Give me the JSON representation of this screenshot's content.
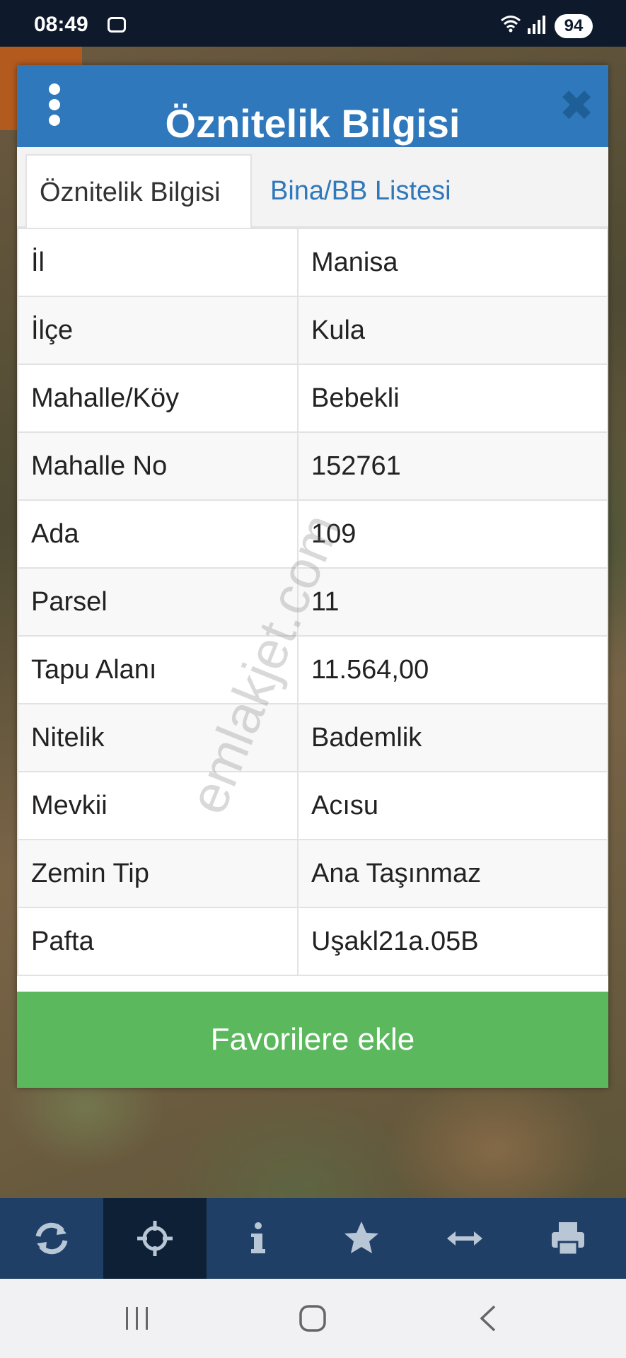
{
  "status_bar": {
    "time": "08:49",
    "battery": "94"
  },
  "modal": {
    "title": "Öznitelik Bilgisi",
    "tabs": [
      {
        "label": "Öznitelik Bilgisi",
        "active": true
      },
      {
        "label": "Bina/BB Listesi",
        "active": false
      }
    ],
    "rows": [
      {
        "key": "İl",
        "value": "Manisa"
      },
      {
        "key": "İlçe",
        "value": "Kula"
      },
      {
        "key": "Mahalle/Köy",
        "value": "Bebekli"
      },
      {
        "key": "Mahalle No",
        "value": "152761"
      },
      {
        "key": "Ada",
        "value": "109"
      },
      {
        "key": "Parsel",
        "value": "11"
      },
      {
        "key": "Tapu Alanı",
        "value": "11.564,00"
      },
      {
        "key": "Nitelik",
        "value": "Bademlik"
      },
      {
        "key": "Mevkii",
        "value": "Acısu"
      },
      {
        "key": "Zemin Tip",
        "value": "Ana Taşınmaz"
      },
      {
        "key": "Pafta",
        "value": "Uşakl21a.05B"
      }
    ],
    "favorite_button": "Favorilere ekle"
  },
  "watermark": "emlakjet.com",
  "toolbar": {
    "items": [
      "refresh-icon",
      "crosshair-icon",
      "info-icon",
      "star-icon",
      "measure-icon",
      "print-icon"
    ],
    "active_index": 1
  },
  "colors": {
    "header": "#2f78bc",
    "button": "#5cb85c",
    "toolbar": "#1f3f66"
  }
}
